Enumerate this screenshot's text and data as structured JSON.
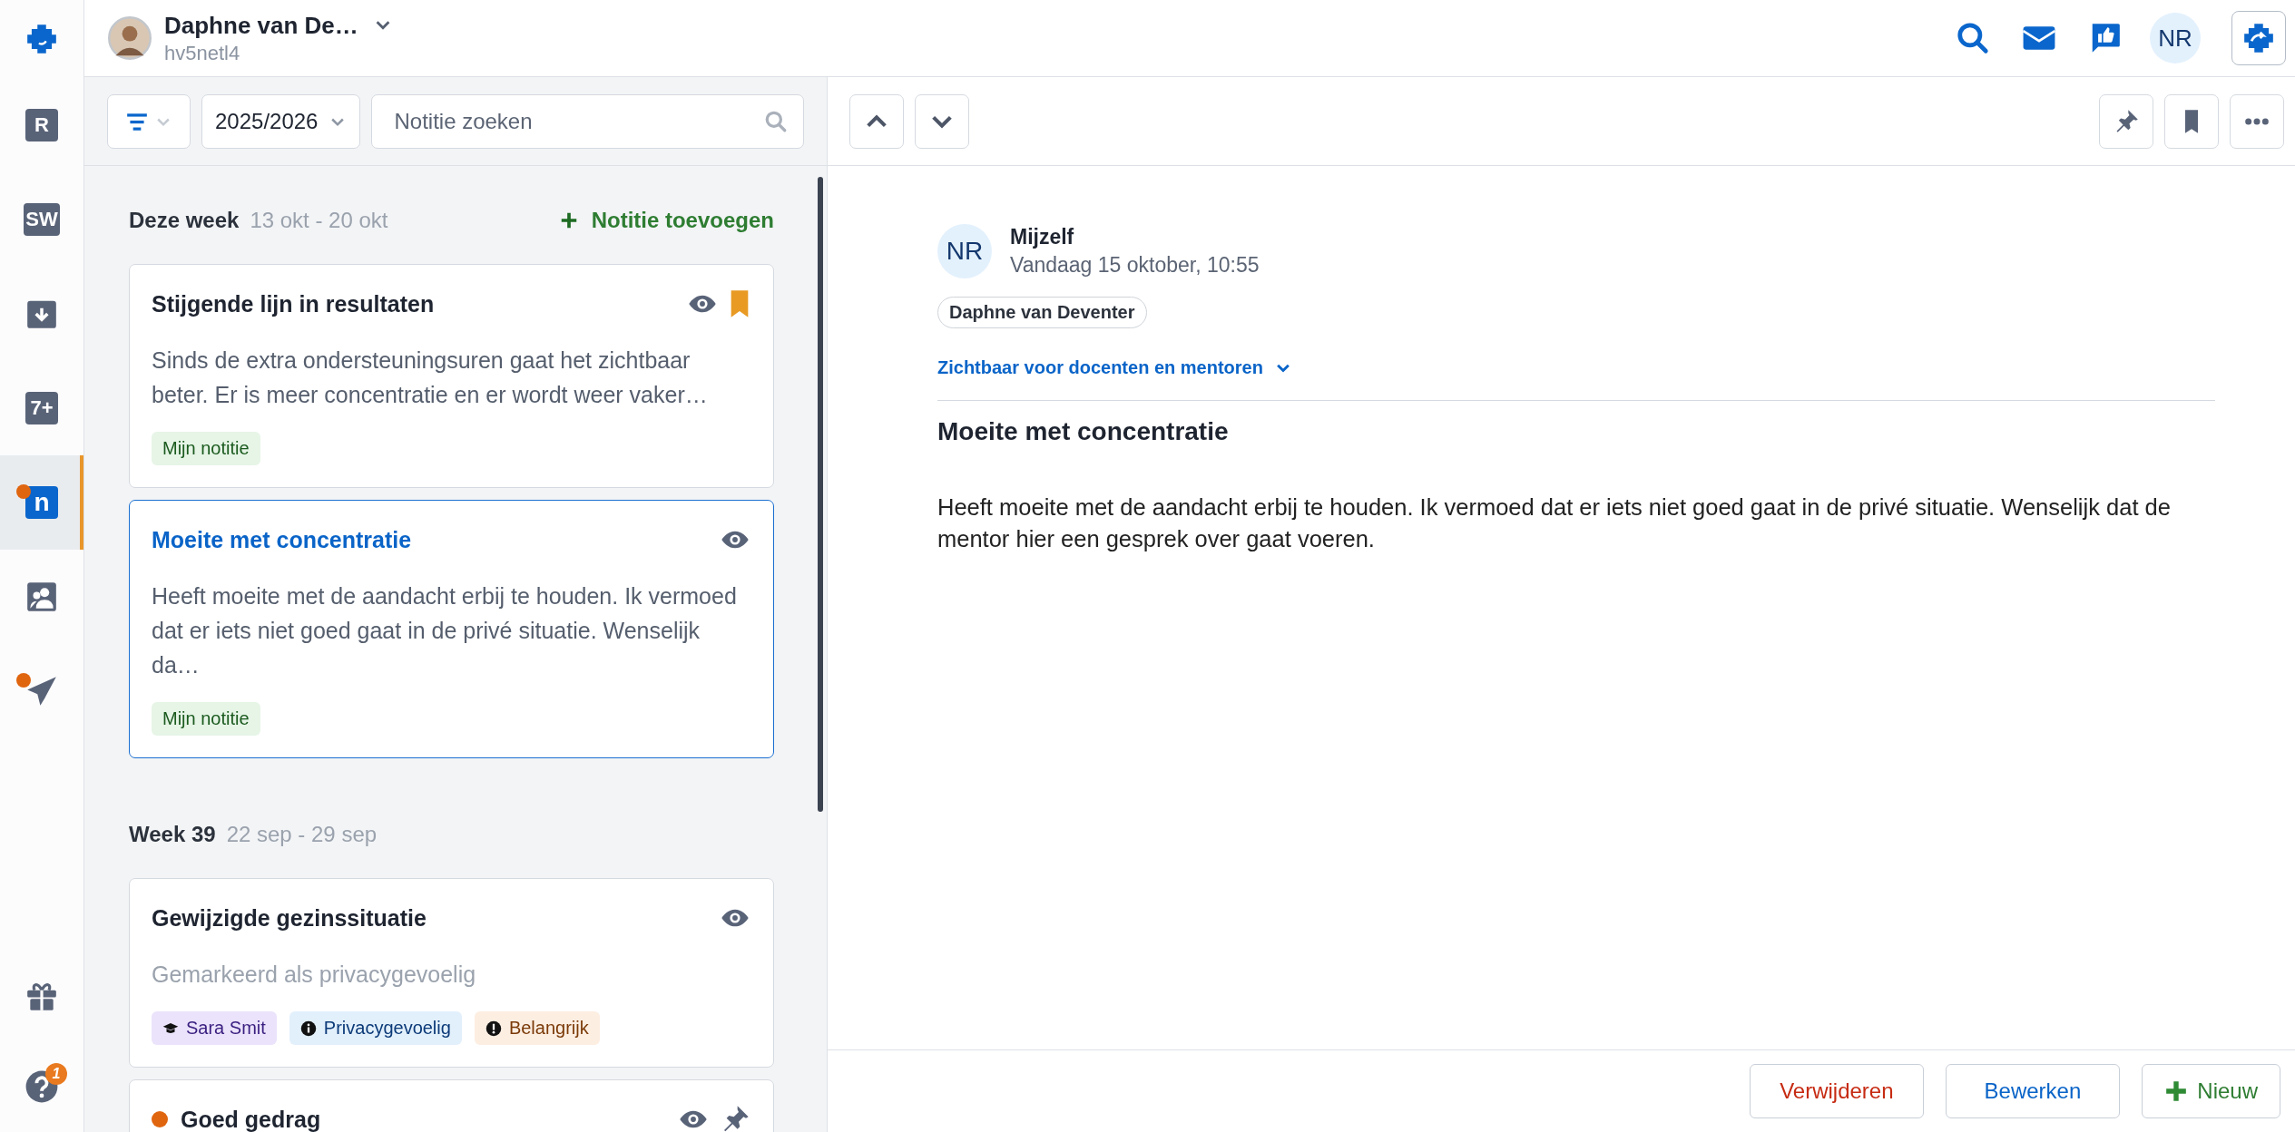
{
  "sidebar": {
    "items": [
      {
        "kind": "logo",
        "selected": false,
        "notification": false
      },
      {
        "kind": "letter",
        "glyph": "R",
        "selected": false,
        "notification": false
      },
      {
        "kind": "letter",
        "glyph": "SW",
        "selected": false,
        "notification": false
      },
      {
        "kind": "download",
        "selected": false,
        "notification": false
      },
      {
        "kind": "letter",
        "glyph": "7+",
        "selected": false,
        "notification": false
      },
      {
        "kind": "letter",
        "glyph": "n",
        "selected": true,
        "notification": true
      },
      {
        "kind": "people",
        "selected": false,
        "notification": false
      },
      {
        "kind": "send",
        "selected": false,
        "notification": true
      }
    ],
    "bottom_items": [
      {
        "kind": "gift"
      },
      {
        "kind": "help",
        "badge": "1"
      }
    ]
  },
  "header": {
    "student": {
      "name": "Daphne van De…",
      "username": "hv5netl4"
    },
    "user_initials": "NR"
  },
  "list": {
    "year": "2025/2026",
    "search": {
      "placeholder": "Notitie zoeken"
    },
    "add_label": "Notitie toevoegen",
    "groups": [
      {
        "title": "Deze week",
        "range": "13 okt - 20 okt",
        "notes": [
          {
            "title": "Stijgende lijn in resultaten",
            "selected": false,
            "bookmarked": true,
            "pinned": false,
            "preview": "Sinds de extra ondersteuningsuren gaat het zichtbaar beter. Er is meer concentratie en er wordt weer vaker…",
            "muted": false,
            "tags": [
              {
                "label": "Mijn notitie",
                "kind": "own"
              }
            ]
          },
          {
            "title": "Moeite met concentratie",
            "selected": true,
            "bookmarked": false,
            "pinned": false,
            "preview": "Heeft moeite met de aandacht erbij te houden. Ik vermoed dat er iets niet goed gaat in de privé situatie. Wenselijk da…",
            "muted": false,
            "tags": [
              {
                "label": "Mijn notitie",
                "kind": "own"
              }
            ]
          }
        ]
      },
      {
        "title": "Week 39",
        "range": "22 sep - 29 sep",
        "notes": [
          {
            "title": "Gewijzigde gezinssituatie",
            "selected": false,
            "bookmarked": false,
            "pinned": false,
            "preview": "Gemarkeerd als privacygevoelig",
            "muted": true,
            "tags": [
              {
                "label": "Sara Smit",
                "kind": "student"
              },
              {
                "label": "Privacygevoelig",
                "kind": "privacy"
              },
              {
                "label": "Belangrijk",
                "kind": "important"
              }
            ]
          },
          {
            "title": "Goed gedrag",
            "selected": false,
            "bookmarked": false,
            "pinned": true,
            "color": "#e0650f"
          }
        ]
      }
    ]
  },
  "detail": {
    "author_initials": "NR",
    "author": "Mijzelf",
    "date": "Vandaag 15 oktober, 10:55",
    "student": "Daphne van Deventer",
    "visibility": "Zichtbaar voor docenten en mentoren",
    "title": "Moeite met concentratie",
    "body": "Heeft moeite met de aandacht erbij te houden. Ik vermoed dat er iets niet goed gaat in de privé situatie. Wenselijk dat de mentor hier een gesprek over gaat voeren.",
    "buttons": [
      {
        "label": "Verwijderen",
        "kind": "danger"
      },
      {
        "label": "Bewerken",
        "kind": "primary"
      },
      {
        "label": "Nieuw",
        "kind": "add"
      }
    ]
  }
}
